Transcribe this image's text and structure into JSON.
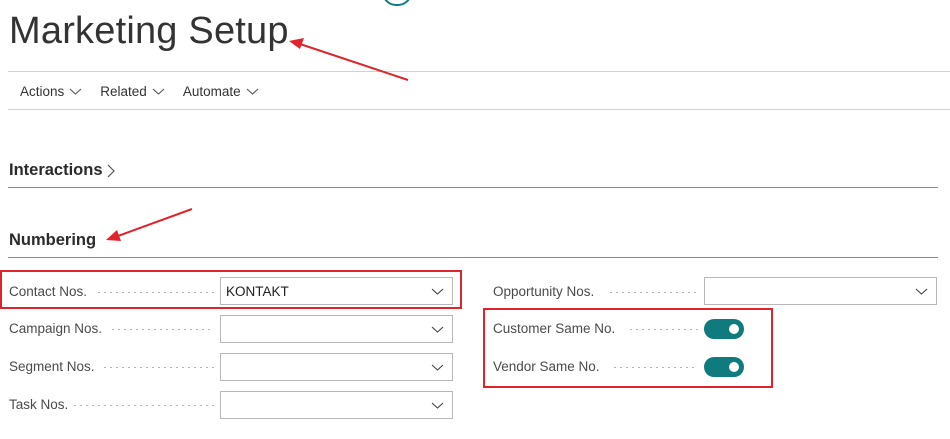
{
  "page": {
    "title": "Marketing Setup"
  },
  "actions": [
    {
      "label": "Actions"
    },
    {
      "label": "Related"
    },
    {
      "label": "Automate"
    }
  ],
  "sections": {
    "interactions": {
      "title": "Interactions"
    },
    "numbering": {
      "title": "Numbering"
    }
  },
  "fields": {
    "contact_nos": {
      "label": "Contact Nos.",
      "value": "KONTAKT"
    },
    "campaign_nos": {
      "label": "Campaign Nos.",
      "value": ""
    },
    "segment_nos": {
      "label": "Segment Nos.",
      "value": ""
    },
    "task_nos": {
      "label": "Task Nos.",
      "value": ""
    },
    "opportunity_nos": {
      "label": "Opportunity Nos.",
      "value": ""
    },
    "customer_same_no": {
      "label": "Customer Same No.",
      "value": true
    },
    "vendor_same_no": {
      "label": "Vendor Same No.",
      "value": true
    }
  },
  "colors": {
    "accent": "#0f7b7e",
    "annotation": "#e0242c"
  }
}
